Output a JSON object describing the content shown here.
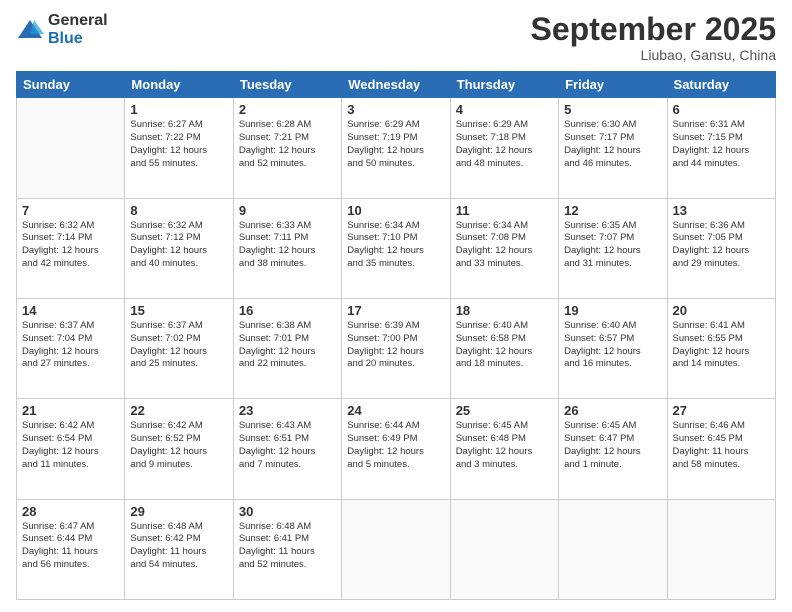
{
  "header": {
    "logo_general": "General",
    "logo_blue": "Blue",
    "title": "September 2025",
    "location": "Liubao, Gansu, China"
  },
  "weekdays": [
    "Sunday",
    "Monday",
    "Tuesday",
    "Wednesday",
    "Thursday",
    "Friday",
    "Saturday"
  ],
  "weeks": [
    [
      {
        "day": "",
        "info": ""
      },
      {
        "day": "1",
        "info": "Sunrise: 6:27 AM\nSunset: 7:22 PM\nDaylight: 12 hours\nand 55 minutes."
      },
      {
        "day": "2",
        "info": "Sunrise: 6:28 AM\nSunset: 7:21 PM\nDaylight: 12 hours\nand 52 minutes."
      },
      {
        "day": "3",
        "info": "Sunrise: 6:29 AM\nSunset: 7:19 PM\nDaylight: 12 hours\nand 50 minutes."
      },
      {
        "day": "4",
        "info": "Sunrise: 6:29 AM\nSunset: 7:18 PM\nDaylight: 12 hours\nand 48 minutes."
      },
      {
        "day": "5",
        "info": "Sunrise: 6:30 AM\nSunset: 7:17 PM\nDaylight: 12 hours\nand 46 minutes."
      },
      {
        "day": "6",
        "info": "Sunrise: 6:31 AM\nSunset: 7:15 PM\nDaylight: 12 hours\nand 44 minutes."
      }
    ],
    [
      {
        "day": "7",
        "info": "Sunrise: 6:32 AM\nSunset: 7:14 PM\nDaylight: 12 hours\nand 42 minutes."
      },
      {
        "day": "8",
        "info": "Sunrise: 6:32 AM\nSunset: 7:12 PM\nDaylight: 12 hours\nand 40 minutes."
      },
      {
        "day": "9",
        "info": "Sunrise: 6:33 AM\nSunset: 7:11 PM\nDaylight: 12 hours\nand 38 minutes."
      },
      {
        "day": "10",
        "info": "Sunrise: 6:34 AM\nSunset: 7:10 PM\nDaylight: 12 hours\nand 35 minutes."
      },
      {
        "day": "11",
        "info": "Sunrise: 6:34 AM\nSunset: 7:08 PM\nDaylight: 12 hours\nand 33 minutes."
      },
      {
        "day": "12",
        "info": "Sunrise: 6:35 AM\nSunset: 7:07 PM\nDaylight: 12 hours\nand 31 minutes."
      },
      {
        "day": "13",
        "info": "Sunrise: 6:36 AM\nSunset: 7:05 PM\nDaylight: 12 hours\nand 29 minutes."
      }
    ],
    [
      {
        "day": "14",
        "info": "Sunrise: 6:37 AM\nSunset: 7:04 PM\nDaylight: 12 hours\nand 27 minutes."
      },
      {
        "day": "15",
        "info": "Sunrise: 6:37 AM\nSunset: 7:02 PM\nDaylight: 12 hours\nand 25 minutes."
      },
      {
        "day": "16",
        "info": "Sunrise: 6:38 AM\nSunset: 7:01 PM\nDaylight: 12 hours\nand 22 minutes."
      },
      {
        "day": "17",
        "info": "Sunrise: 6:39 AM\nSunset: 7:00 PM\nDaylight: 12 hours\nand 20 minutes."
      },
      {
        "day": "18",
        "info": "Sunrise: 6:40 AM\nSunset: 6:58 PM\nDaylight: 12 hours\nand 18 minutes."
      },
      {
        "day": "19",
        "info": "Sunrise: 6:40 AM\nSunset: 6:57 PM\nDaylight: 12 hours\nand 16 minutes."
      },
      {
        "day": "20",
        "info": "Sunrise: 6:41 AM\nSunset: 6:55 PM\nDaylight: 12 hours\nand 14 minutes."
      }
    ],
    [
      {
        "day": "21",
        "info": "Sunrise: 6:42 AM\nSunset: 6:54 PM\nDaylight: 12 hours\nand 11 minutes."
      },
      {
        "day": "22",
        "info": "Sunrise: 6:42 AM\nSunset: 6:52 PM\nDaylight: 12 hours\nand 9 minutes."
      },
      {
        "day": "23",
        "info": "Sunrise: 6:43 AM\nSunset: 6:51 PM\nDaylight: 12 hours\nand 7 minutes."
      },
      {
        "day": "24",
        "info": "Sunrise: 6:44 AM\nSunset: 6:49 PM\nDaylight: 12 hours\nand 5 minutes."
      },
      {
        "day": "25",
        "info": "Sunrise: 6:45 AM\nSunset: 6:48 PM\nDaylight: 12 hours\nand 3 minutes."
      },
      {
        "day": "26",
        "info": "Sunrise: 6:45 AM\nSunset: 6:47 PM\nDaylight: 12 hours\nand 1 minute."
      },
      {
        "day": "27",
        "info": "Sunrise: 6:46 AM\nSunset: 6:45 PM\nDaylight: 11 hours\nand 58 minutes."
      }
    ],
    [
      {
        "day": "28",
        "info": "Sunrise: 6:47 AM\nSunset: 6:44 PM\nDaylight: 11 hours\nand 56 minutes."
      },
      {
        "day": "29",
        "info": "Sunrise: 6:48 AM\nSunset: 6:42 PM\nDaylight: 11 hours\nand 54 minutes."
      },
      {
        "day": "30",
        "info": "Sunrise: 6:48 AM\nSunset: 6:41 PM\nDaylight: 11 hours\nand 52 minutes."
      },
      {
        "day": "",
        "info": ""
      },
      {
        "day": "",
        "info": ""
      },
      {
        "day": "",
        "info": ""
      },
      {
        "day": "",
        "info": ""
      }
    ]
  ]
}
